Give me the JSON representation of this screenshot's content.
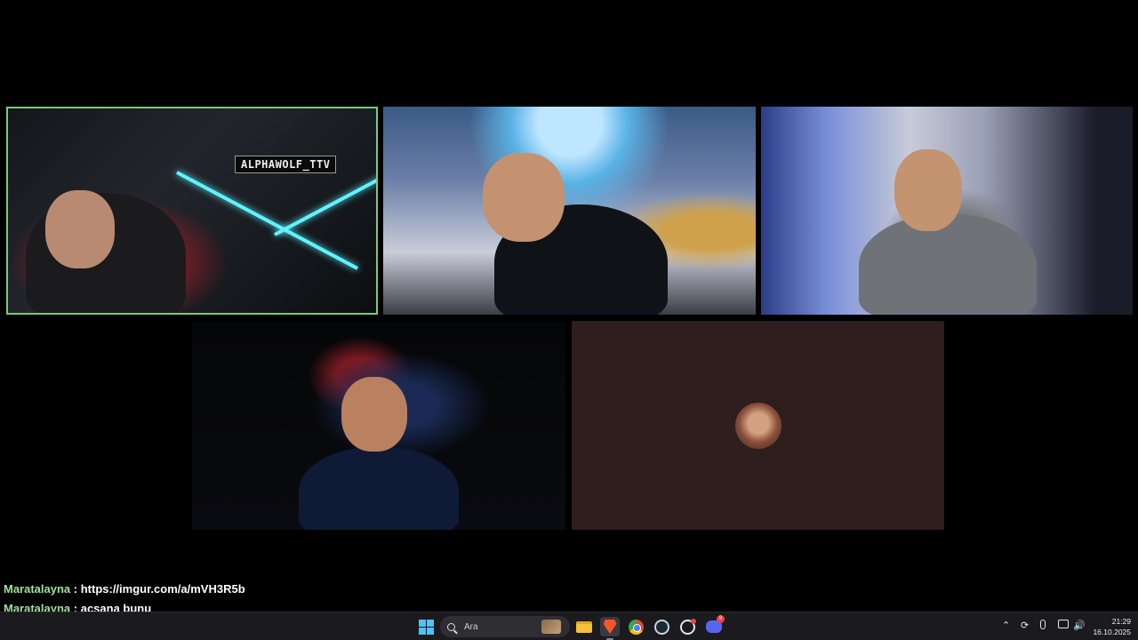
{
  "stream": {
    "tiles": [
      {
        "id": "tile-1",
        "overlay_text": "ALPHAWOLF_TTV",
        "highlighted": true,
        "highlight_color": "#7cc97a"
      },
      {
        "id": "tile-2"
      },
      {
        "id": "tile-3"
      },
      {
        "id": "tile-4"
      },
      {
        "id": "tile-5",
        "type": "avatar-only",
        "background": "#2e1e1e"
      }
    ]
  },
  "chat": {
    "user_color": "#9ee29b",
    "messages": [
      {
        "user": "Maratalayna",
        "sep": " : ",
        "text": "https://imgur.com/a/mVH3R5b"
      },
      {
        "user": "Maratalayna",
        "sep": " : ",
        "text": "açsana bunu"
      }
    ]
  },
  "taskbar": {
    "search_placeholder": "Ara",
    "apps": [
      {
        "name": "start",
        "icon": "windows-logo-icon"
      },
      {
        "name": "file-explorer",
        "icon": "folder-icon"
      },
      {
        "name": "brave",
        "icon": "brave-browser-icon",
        "active": true
      },
      {
        "name": "chrome",
        "icon": "chrome-icon"
      },
      {
        "name": "steam",
        "icon": "steam-icon"
      },
      {
        "name": "github-desktop",
        "icon": "github-icon"
      },
      {
        "name": "discord",
        "icon": "discord-icon",
        "badge": "9"
      }
    ],
    "tray": {
      "icons": [
        "chevron-up-icon",
        "sync-icon",
        "microphone-icon",
        "network-icon",
        "volume-icon"
      ],
      "time": "21:29",
      "date": "16.10.2025"
    }
  }
}
